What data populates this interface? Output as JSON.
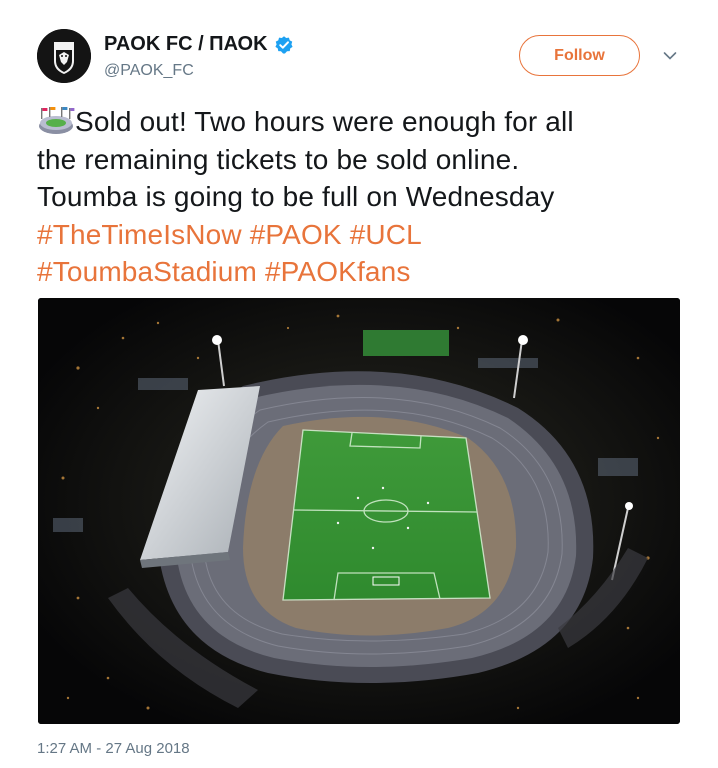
{
  "account": {
    "display_name": "PAOK FC / ΠΑΟΚ",
    "handle": "@PAOK_FC",
    "verified": true,
    "avatar_icon": "paok-crest-icon"
  },
  "actions": {
    "follow_label": "Follow",
    "more_icon": "chevron-down-icon"
  },
  "tweet": {
    "emoji_icon": "stadium-emoji-icon",
    "text_lines": [
      "Sold out! Two hours were enough for all",
      "the remaining tickets to be sold online.",
      "Toumba is going to be full on Wednesday"
    ],
    "hashtags": [
      "#TheTimeIsNow",
      "#PAOK",
      "#UCL",
      "#ToumbaStadium",
      "#PAOKfans"
    ],
    "photo_icon": "stadium-aerial-photo",
    "timestamp": "1:27 AM - 27 Aug 2018"
  },
  "colors": {
    "accent": "#e8743b",
    "text": "#14171a",
    "muted": "#657786",
    "verified": "#1da1f2"
  }
}
